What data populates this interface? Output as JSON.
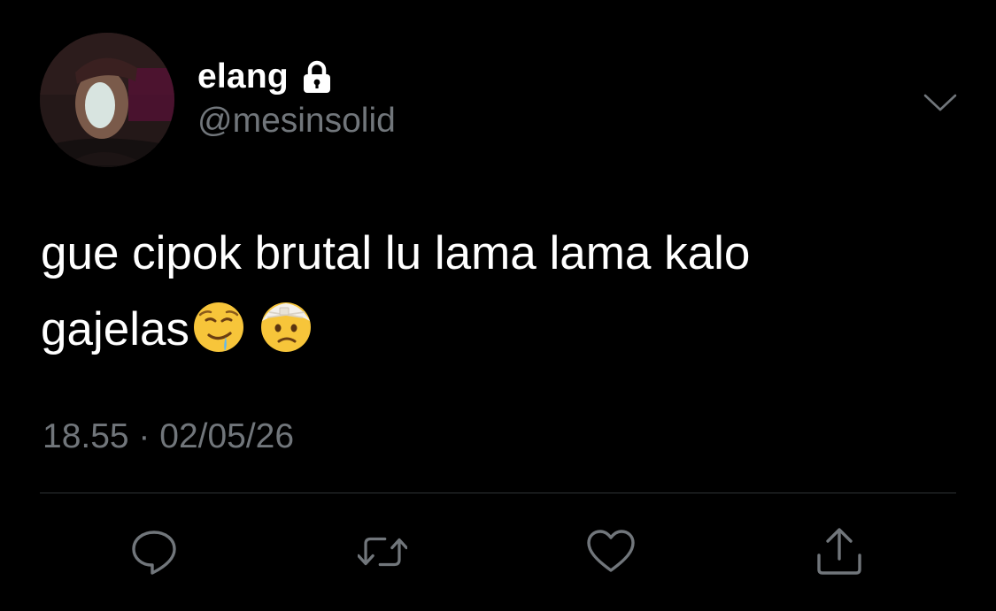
{
  "user": {
    "display_name": "elang",
    "handle": "@mesinsolid",
    "protected": true
  },
  "tweet": {
    "text_line1": "gue cipok brutal lu lama lama kalo",
    "text_line2": "gajelas",
    "emojis": [
      "drooling-face",
      "face-with-head-bandage"
    ],
    "timestamp": "18.55 · 02/05/26"
  },
  "actions": [
    "reply-icon",
    "retweet-icon",
    "like-icon",
    "share-icon"
  ],
  "colors": {
    "background": "#000000",
    "primary_text": "#ffffff",
    "secondary_text": "#71767b",
    "divider": "#2f3336"
  }
}
